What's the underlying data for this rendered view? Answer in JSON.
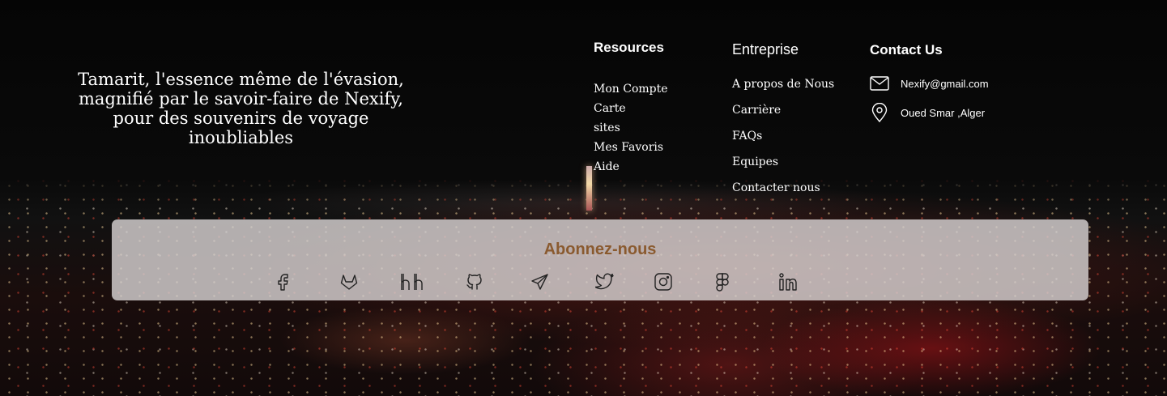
{
  "tagline": "Tamarit, l'essence même de l'évasion, magnifié par le savoir-faire de Nexify, pour des souvenirs de voyage inoubliables",
  "resources": {
    "title": "Resources",
    "items": [
      "Mon Compte",
      "Carte",
      "sites",
      "Mes Favoris",
      "Aide"
    ]
  },
  "entreprise": {
    "title": "Entreprise",
    "items": [
      "A propos de Nous",
      "Carrière",
      "FAQs",
      "Equipes",
      "Contacter nous"
    ]
  },
  "contact": {
    "title": "Contact Us",
    "email": "Nexify@gmail.com",
    "address": "Oued Smar ,Alger",
    "email_icon": "mail-icon",
    "address_icon": "map-pin-icon"
  },
  "subscribe": {
    "title": "Abonnez-nous",
    "socials": [
      "facebook-icon",
      "gitlab-icon",
      "headhunter-icon",
      "github-icon",
      "telegram-icon",
      "twitter-icon",
      "instagram-icon",
      "figma-icon",
      "linkedin-icon"
    ]
  },
  "colors": {
    "panel_bg": "#d7d2d2",
    "subscribe_title": "#8a5a2f",
    "text": "#ffffff"
  }
}
